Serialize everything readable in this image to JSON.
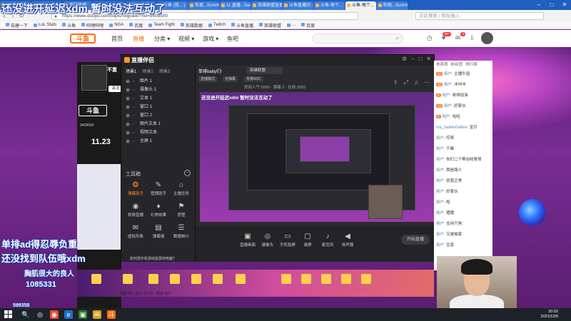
{
  "browser": {
    "tabs": [
      "(有声) 鸡乱...",
      "与他...Summ",
      "英雄联盟",
      "League",
      "英雄联盟",
      "斗鱼 (我... )",
      "你真...Summ",
      "11 直播...Summ",
      "英雄联盟直播...",
      "斗鱼直播间 ...",
      "斗鱼-每个...",
      "斗鱼-每个...",
      "和他...Summ"
    ],
    "url": "https://www.douyu.com/topic/lolgoaw/?rid=9408500",
    "search_placeholder": "点此搜索 / 网址输入",
    "window_controls": [
      "–",
      "□",
      "✕"
    ]
  },
  "bookmarks": [
    "自建一下",
    "LoL Stats",
    "斗鱼",
    "哔哩哔哩",
    "NGA",
    "百度",
    "Team Fight",
    "英雄数据",
    "Twitch",
    "斗鱼直播",
    "英雄联盟",
    "...",
    "百度"
  ],
  "site": {
    "logo_text": "斗鱼",
    "nav": [
      {
        "label": "首页",
        "active": false
      },
      {
        "label": "直播",
        "active": true
      },
      {
        "label": "分类 ▾",
        "active": false
      },
      {
        "label": "视频 ▾",
        "active": false
      },
      {
        "label": "游戏 ▾",
        "active": false
      },
      {
        "label": "鱼吧",
        "active": false
      }
    ],
    "notif_badge_1": "99+",
    "notif_badge_2": "3"
  },
  "streamer": {
    "name": "不重",
    "follow_label": "关注",
    "room_logo": "斗鱼",
    "room_id": "9408500",
    "date_badge": "11.23"
  },
  "app": {
    "title": "直播伴侣",
    "scene_tabs": [
      "场景1",
      "场景2",
      "场景3"
    ],
    "sources": [
      {
        "name": "图片 1"
      },
      {
        "name": "摄像头 1"
      },
      {
        "name": "文本 1"
      },
      {
        "name": "窗口 1"
      },
      {
        "name": "窗口 2"
      },
      {
        "name": "图片文本 1"
      },
      {
        "name": "视频文本"
      },
      {
        "name": "全屏 1"
      }
    ],
    "toolbox_label": "工具箱",
    "tools": [
      {
        "icon": "❂",
        "label": "弹幕助手",
        "active": true
      },
      {
        "icon": "✎",
        "label": "管理助手",
        "active": false
      },
      {
        "icon": "⌂",
        "label": "主播任务",
        "active": false
      },
      {
        "icon": "◉",
        "label": "视频直播",
        "active": false
      },
      {
        "icon": "♦",
        "label": "礼物效果",
        "active": false
      },
      {
        "icon": "⚑",
        "label": "房管",
        "active": false
      },
      {
        "icon": "✉",
        "label": "虚拟形象",
        "active": false
      },
      {
        "icon": "▤",
        "label": "弹幕墙",
        "active": false
      },
      {
        "icon": "☰",
        "label": "数据统计",
        "active": false
      }
    ],
    "stream_title": "单排baby们!",
    "category": "英雄联盟",
    "tags": [
      "直播模式",
      "无弹幕",
      "背景ADC"
    ],
    "stats": "房间人气 5999  ·  弹幕 2  ·  在线 3583",
    "preview_caption": "还没进开延迟xdm 暂时没法互动了",
    "controls": [
      {
        "icon": "▣",
        "label": "直播画面"
      },
      {
        "icon": "◎",
        "label": "摄像头"
      },
      {
        "icon": "▭",
        "label": "手机投屏"
      },
      {
        "icon": "▢",
        "label": "录屏"
      },
      {
        "icon": "♪",
        "label": "麦克风"
      },
      {
        "icon": "◀",
        "label": "扬声器"
      }
    ],
    "start_label": "开始直播",
    "tip": "如何把手机游戏投屏到电脑?"
  },
  "danmu": {
    "top": "还没进开延迟xdm 暂时没法互动了",
    "mid1": "单排ad得忍辱负重",
    "mid2": "还没找到队伍哦xdm",
    "small": "胸肌很大的良人",
    "fan_id": "1085331",
    "fan_sub": "599358"
  },
  "chat": {
    "tabs": [
      "贵宾席",
      "粉丝团",
      "排行榜"
    ],
    "lines": [
      {
        "badge": "21",
        "user": "用户",
        "text": "主播牛逼"
      },
      {
        "badge": "18",
        "user": "用户",
        "text": "冲冲冲"
      },
      {
        "badge": "9",
        "user": "用户",
        "text": "单排加油"
      },
      {
        "badge": "12",
        "user": "用户",
        "text": "好家伙"
      },
      {
        "badge": "6",
        "user": "用户",
        "text": "哈哈"
      },
      {
        "badge": "",
        "user": "mb_SatMoDaRen",
        "text": "宝贝"
      },
      {
        "badge": "",
        "user": "用户",
        "text": "哎呀"
      },
      {
        "badge": "",
        "user": "用户",
        "text": "干嘛"
      },
      {
        "badge": "",
        "user": "用户",
        "text": "你们二个帮出哈哥哥"
      },
      {
        "badge": "",
        "user": "用户",
        "text": "我是路人"
      },
      {
        "badge": "",
        "user": "用户",
        "text": "就我正常"
      },
      {
        "badge": "",
        "user": "用户",
        "text": "好家伙"
      },
      {
        "badge": "",
        "user": "用户",
        "text": "啦"
      },
      {
        "badge": "",
        "user": "用户",
        "text": "猪猪"
      },
      {
        "badge": "",
        "user": "用户",
        "text": "支持只狗"
      },
      {
        "badge": "",
        "user": "用户",
        "text": "又被偷家"
      },
      {
        "badge": "",
        "user": "用户",
        "text": "豆浆"
      }
    ]
  },
  "gifts": {
    "stats": "贡献 99  ·  鱼丸 42125  ·  粉丝 99+"
  },
  "taskbar": {
    "apps": [
      "🔍",
      "◎",
      "◉",
      "e",
      "▣",
      "✉",
      "斗"
    ],
    "time": "20:02",
    "date": "2021/12/5"
  }
}
